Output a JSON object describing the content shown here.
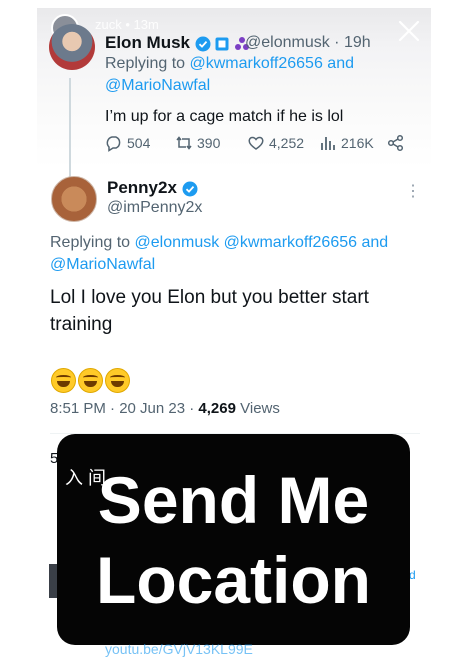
{
  "story": {
    "username": "zuck • 13m"
  },
  "elon_tweet": {
    "name": "Elon Musk",
    "handle": "@elonmusk",
    "separator": "·",
    "time": "19h",
    "replying_prefix": "Replying to",
    "replying_line1_links": "@kwmarkoff26656 and",
    "replying_line2_links": "@MarioNawfal",
    "text": "I’m up for a cage match if he is lol",
    "replies": "504",
    "retweets": "390",
    "likes": "4,252",
    "views": "216K"
  },
  "penny_tweet": {
    "name": "Penny2x",
    "handle": "@imPenny2x",
    "replying_prefix": "Replying to",
    "replying_line1_links": "@elonmusk @kwmarkoff26656 and",
    "replying_line2_links": "@MarioNawfal",
    "text": "Lol I love you Elon but you better start training",
    "time": "8:51 PM · 20 Jun 23 ·",
    "views_count": "4,269",
    "views_label": "Views"
  },
  "overlay": {
    "line1": "Send Me",
    "line2": "Location"
  },
  "peek": {
    "text_left": "5",
    "text_overlay": "入 间",
    "link_right": "d",
    "bottom_link": "youtu.be/GVjV13KL99E"
  },
  "colors": {
    "link": "#1d9bf0",
    "text": "#0f1419",
    "secondary": "#536471",
    "overlay_bg": "#050505"
  }
}
